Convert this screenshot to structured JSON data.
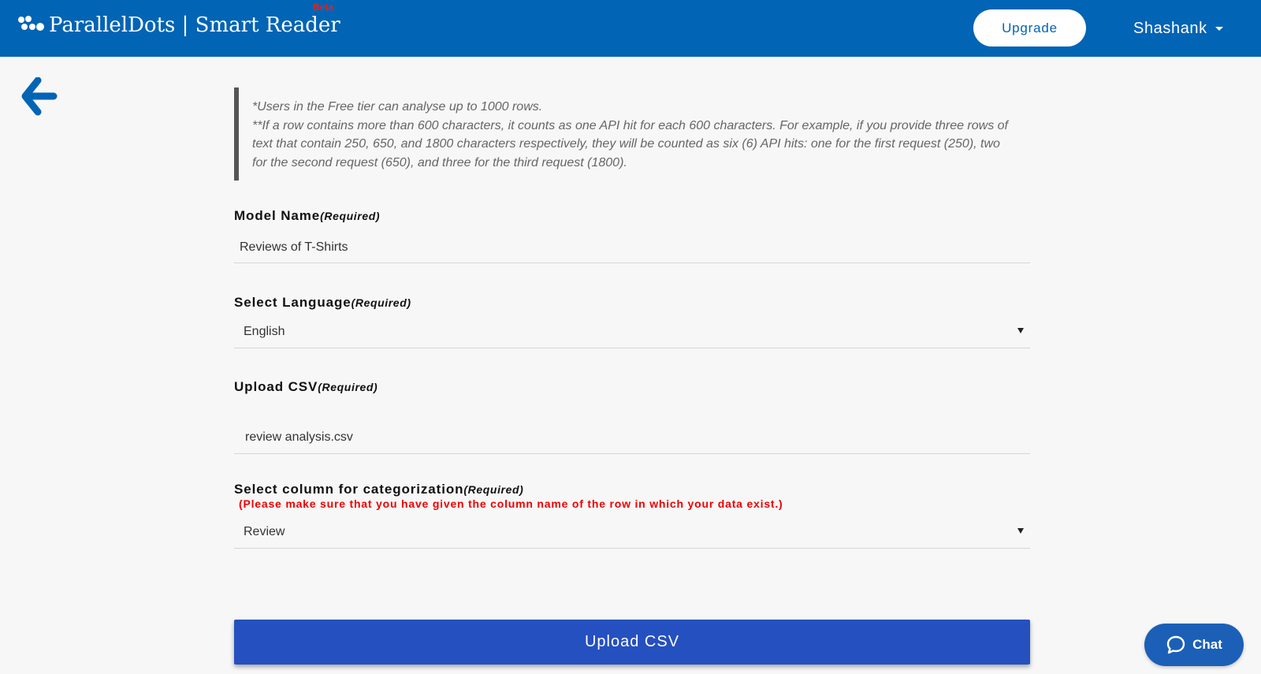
{
  "header": {
    "brand": "ParallelDots | Smart Reader",
    "badge": "Beta",
    "upgrade_label": "Upgrade",
    "user_name": "Shashank"
  },
  "notice": {
    "line1": "*Users in the Free tier can analyse up to 1000 rows.",
    "line2": "**If a row contains more than 600 characters, it counts as one API hit for each 600 characters. For example, if you provide three rows of text that contain 250, 650, and 1800 characters respectively, they will be counted as six (6) API hits: one for the first request (250), two for the second request (650), and three for the third request (1800)."
  },
  "form": {
    "required_tag": "(Required)",
    "model_name": {
      "label": "Model Name",
      "value": "Reviews of T-Shirts"
    },
    "language": {
      "label": "Select Language",
      "value": "English"
    },
    "upload": {
      "label": "Upload CSV",
      "value": "review analysis.csv"
    },
    "column": {
      "label": "Select column for categorization",
      "warning": "(Please make sure that you have given the column name of the row in which your data exist.)",
      "value": "Review"
    },
    "submit_label": "Upload CSV"
  },
  "chat": {
    "label": "Chat"
  },
  "colors": {
    "header": "#0264b4",
    "primary_button": "#2550bf",
    "warning": "#ee0000",
    "badge": "#e2231a"
  },
  "icons": {
    "back": "arrow-left-icon",
    "logo": "dots-logo-icon",
    "chat": "chat-bubble-icon",
    "dropdown": "caret-down-icon"
  }
}
